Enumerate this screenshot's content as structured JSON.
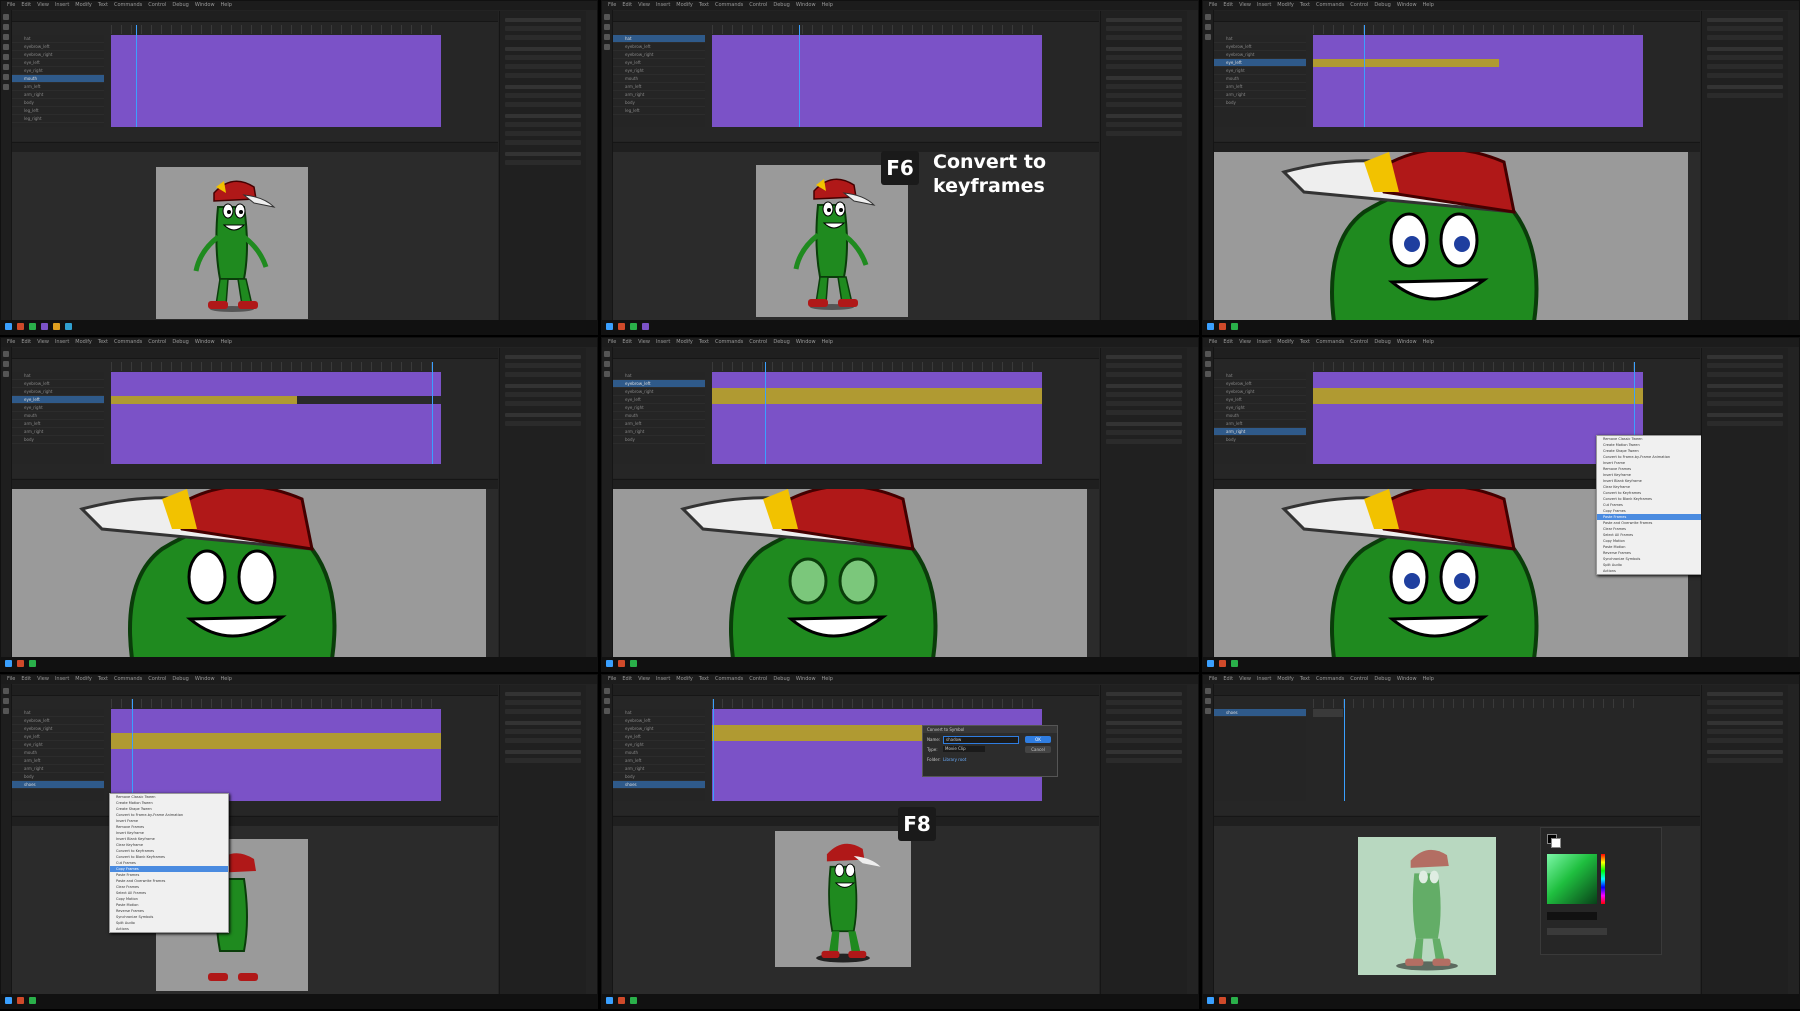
{
  "menu": [
    "File",
    "Edit",
    "View",
    "Insert",
    "Modify",
    "Text",
    "Commands",
    "Control",
    "Debug",
    "Window",
    "Help"
  ],
  "layers": [
    "hat",
    "eyebrow_left",
    "eyebrow_right",
    "eye_left",
    "eye_right",
    "mouth",
    "arm_left",
    "arm_right",
    "body",
    "leg_left",
    "leg_right",
    "shoes"
  ],
  "overlays": {
    "f6_key": "F6",
    "f6_caption_line1": "Convert to",
    "f6_caption_line2": "keyframes",
    "f8_key": "F8"
  },
  "dialog": {
    "title": "Convert to Symbol",
    "name_label": "Name:",
    "name_value": "shadow",
    "type_label": "Type:",
    "type_value": "Movie Clip",
    "folder_label": "Folder:",
    "folder_value": "Library root",
    "ok": "OK",
    "cancel": "Cancel"
  },
  "context_menu": [
    "Remove Classic Tween",
    "Create Motion Tween",
    "Create Shape Tween",
    "Convert to Frame-by-Frame Animation",
    "Insert Frame",
    "Remove Frames",
    "Insert Keyframe",
    "Insert Blank Keyframe",
    "Clear Keyframe",
    "Convert to Keyframes",
    "Convert to Blank Keyframes",
    "Cut Frames",
    "Copy Frames",
    "Paste Frames",
    "Paste and Overwrite Frames",
    "Clear Frames",
    "Select All Frames",
    "Copy Motion",
    "Paste Motion",
    "Reverse Frames",
    "Synchronize Symbols",
    "Split Audio",
    "Actions"
  ],
  "context_menu_highlight_left": "Copy Frames",
  "context_menu_highlight_right": "Paste Frames",
  "colors": {
    "frames_purple": "#7b52c7",
    "frames_gold": "#b09a32",
    "accent_blue": "#3aa0ff",
    "pickle_green": "#1f8a1f",
    "cap_red": "#b01818",
    "cap_yellow": "#f2c200"
  }
}
